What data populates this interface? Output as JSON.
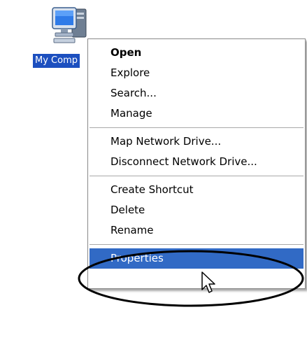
{
  "desktop": {
    "icon_label": "My Comp",
    "icon_name": "my-computer-icon"
  },
  "menu": {
    "items": [
      {
        "label": "Open",
        "default": true
      },
      {
        "label": "Explore"
      },
      {
        "label": "Search..."
      },
      {
        "label": "Manage"
      },
      {
        "label": "Map Network Drive..."
      },
      {
        "label": "Disconnect Network Drive..."
      },
      {
        "label": "Create Shortcut"
      },
      {
        "label": "Delete"
      },
      {
        "label": "Rename"
      },
      {
        "label": "Properties",
        "highlighted": true
      }
    ]
  },
  "colors": {
    "selection": "#316ac5",
    "icon_label_bg": "#1c4fbf",
    "annotation": "#000000"
  },
  "cursor": {
    "icon_name": "arrow-cursor-icon"
  }
}
